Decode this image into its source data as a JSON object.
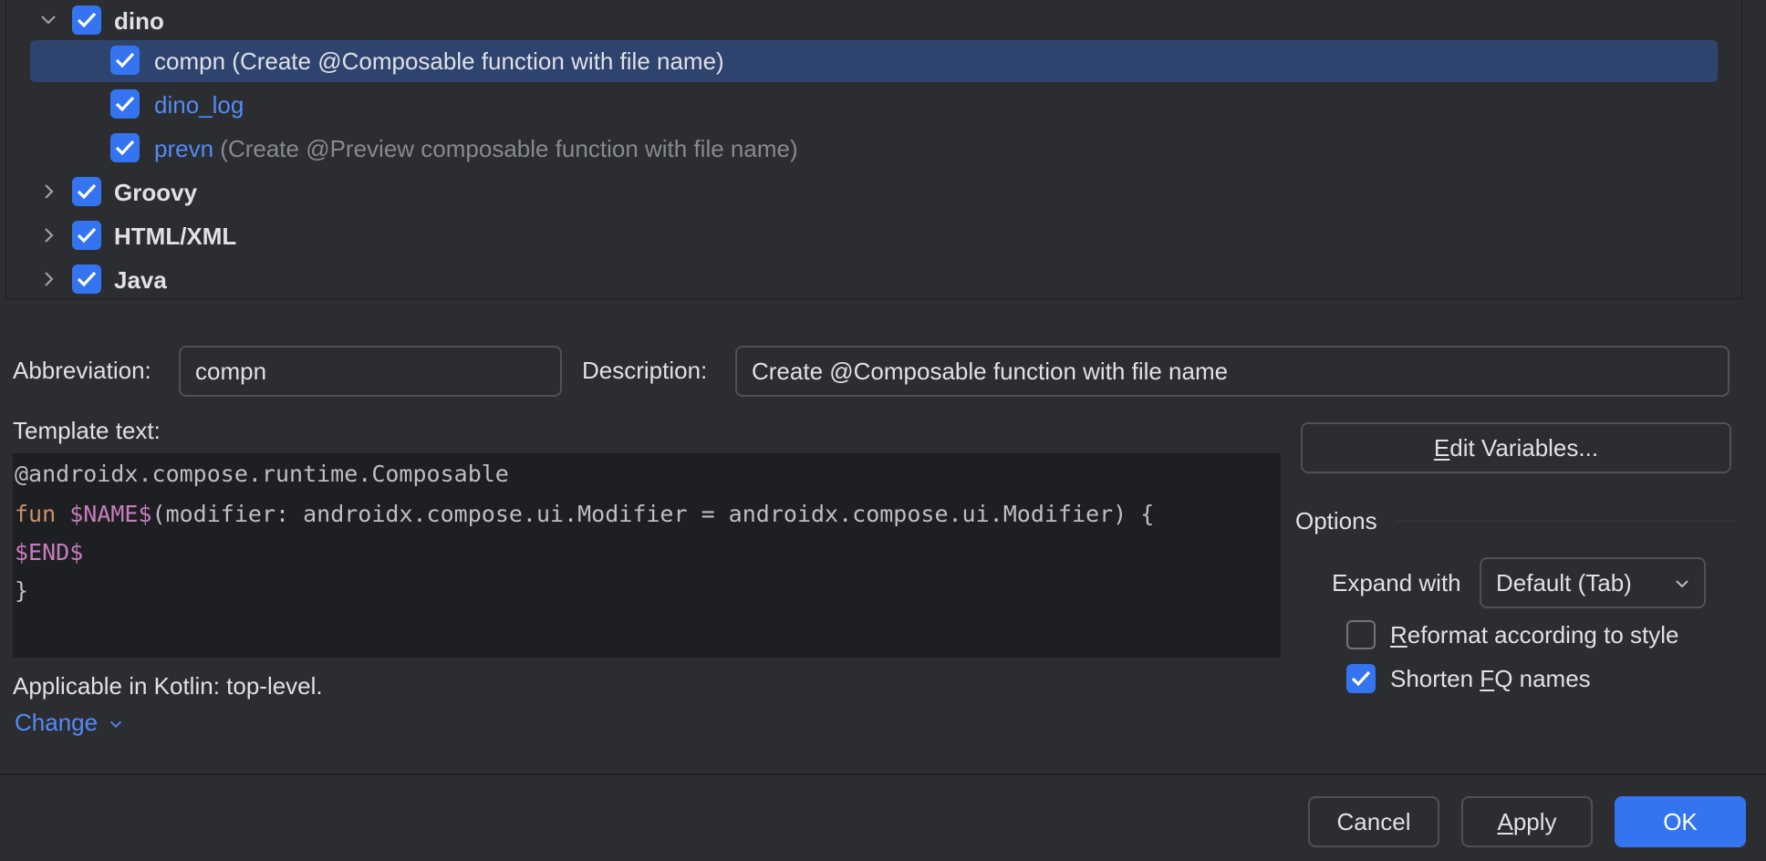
{
  "tree": {
    "groups": [
      {
        "name": "dino",
        "expanded": true,
        "checked": true
      },
      {
        "name": "Groovy",
        "expanded": false,
        "checked": true
      },
      {
        "name": "HTML/XML",
        "expanded": false,
        "checked": true
      },
      {
        "name": "Java",
        "expanded": false,
        "checked": true
      }
    ],
    "items": [
      {
        "abbr": "compn",
        "desc": "(Create @Composable function with file name)",
        "checked": true,
        "selected": true
      },
      {
        "abbr": "dino_log",
        "desc": "",
        "checked": true,
        "selected": false
      },
      {
        "abbr": "prevn",
        "desc": "(Create @Preview composable function with file name)",
        "checked": true,
        "selected": false
      }
    ]
  },
  "form": {
    "abbreviation_label": "Abbreviation:",
    "abbreviation_value": "compn",
    "description_label": "Description:",
    "description_value": "Create @Composable function with file name",
    "template_text_label": "Template text:"
  },
  "editor": {
    "line1": "@androidx.compose.runtime.Composable",
    "line2_kw": "fun",
    "line2_var": "$NAME$",
    "line2_rest": "(modifier: androidx.compose.ui.Modifier = androidx.compose.ui.Modifier) {",
    "line3_var": "$END$",
    "line4": "}"
  },
  "context": {
    "applicable_text": "Applicable in Kotlin: top-level.",
    "change_link": "Change"
  },
  "options": {
    "edit_variables_first": "E",
    "edit_variables_rest": "dit Variables...",
    "section_title": "Options",
    "expand_with_label": "Expand with",
    "expand_with_value": "Default (Tab)",
    "reformat_first": "R",
    "reformat_rest": "eformat according to style",
    "reformat_checked": false,
    "shorten_before": "Shorten ",
    "shorten_mn": "F",
    "shorten_after": "Q names",
    "shorten_checked": true
  },
  "buttons": {
    "cancel": "Cancel",
    "apply_first": "A",
    "apply_rest": "pply",
    "ok": "OK"
  },
  "colors": {
    "background": "#2b2d30",
    "accent": "#3574f0",
    "selection": "#2e436e",
    "link": "#548af7",
    "editor_bg": "#1e1f22",
    "keyword": "#cf8e6d",
    "template_var": "#c77dbb"
  }
}
